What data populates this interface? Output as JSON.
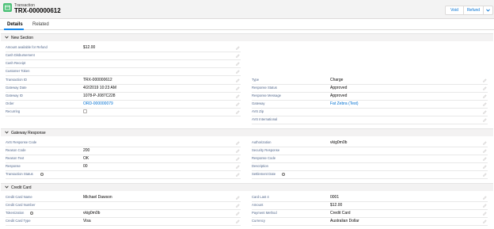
{
  "header": {
    "object_label": "Transaction",
    "record_title": "TRX-000000612",
    "buttons": {
      "void": "Void",
      "refund": "Refund"
    }
  },
  "tabs": [
    {
      "label": "Details"
    },
    {
      "label": "Related"
    }
  ],
  "sections": {
    "new_section": {
      "title": "New Section",
      "left_top": [
        {
          "label": "Amount available for Refund",
          "value": "$12.00"
        },
        {
          "label": "Cash Disbursement",
          "value": ""
        },
        {
          "label": "Cash Receipt",
          "value": ""
        },
        {
          "label": "Customer Token",
          "value": ""
        }
      ],
      "left": [
        {
          "label": "Transaction ID",
          "value": "TRX-000000612"
        },
        {
          "label": "Gateway Date",
          "value": "4/2/2019 10:23 AM"
        },
        {
          "label": "Gateway ID",
          "value": "1078-P-J087C228"
        },
        {
          "label": "Order",
          "value": "ORD-000000079"
        },
        {
          "label": "Recurring",
          "value": ""
        }
      ],
      "right": [
        {
          "label": "Type",
          "value": "Charge"
        },
        {
          "label": "Response Status",
          "value": "Approved"
        },
        {
          "label": "Response Message",
          "value": "Approved"
        },
        {
          "label": "Gateway",
          "value": "Fat Zebra (Test)"
        },
        {
          "label": "AVS Zip",
          "value": ""
        },
        {
          "label": "AVS International",
          "value": ""
        }
      ]
    },
    "gateway_response": {
      "title": "Gateway Response",
      "left": [
        {
          "label": "AVS Response Code",
          "value": ""
        },
        {
          "label": "Reason Code",
          "value": "200"
        },
        {
          "label": "Reason Text",
          "value": "OK"
        },
        {
          "label": "Response",
          "value": "00"
        },
        {
          "label": "Transaction Status",
          "value": ""
        }
      ],
      "right": [
        {
          "label": "Authorization",
          "value": "vkig0m0b"
        },
        {
          "label": "Security Response",
          "value": ""
        },
        {
          "label": "Response Code",
          "value": ""
        },
        {
          "label": "Description",
          "value": ""
        },
        {
          "label": "Settlement Date",
          "value": ""
        }
      ]
    },
    "credit_card": {
      "title": "Credit Card",
      "left": [
        {
          "label": "Credit Card Name",
          "value": "Michael Dawson"
        },
        {
          "label": "Credit Card Number",
          "value": ""
        },
        {
          "label": "Tokenization",
          "value": "vkig0m0b"
        },
        {
          "label": "Credit Card Type",
          "value": "Visa"
        }
      ],
      "right": [
        {
          "label": "Card Last 4",
          "value": "0001"
        },
        {
          "label": "Amount",
          "value": "$12.00"
        },
        {
          "label": "Payment Method",
          "value": "Credit Card"
        },
        {
          "label": "Currency",
          "value": "Australian Dollar"
        }
      ]
    }
  }
}
